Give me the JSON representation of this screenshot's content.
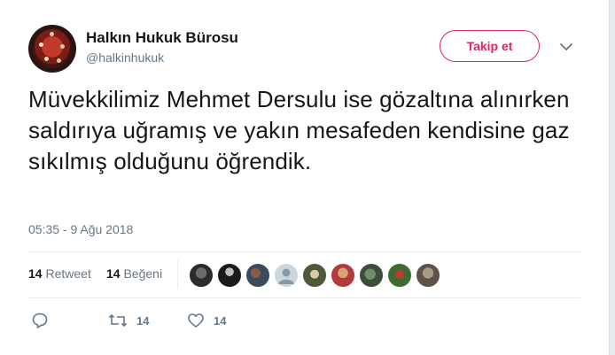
{
  "account": {
    "name": "Halkın Hukuk Bürosu",
    "handle": "@halkinhukuk",
    "follow_label": "Takip et"
  },
  "tweet": {
    "text": "Müvekkilimiz Mehmet Dersulu ise gözaltına alınırken saldırıya uğramış ve yakın mesafeden kendisine gaz sıkılmış olduğunu öğrendik.",
    "timestamp": "05:35 - 9 Ağu 2018"
  },
  "stats": {
    "retweet_count": "14",
    "retweet_label": "Retweet",
    "like_count": "14",
    "like_label": "Beğeni"
  },
  "actions": {
    "retweet_count": "14",
    "like_count": "14"
  },
  "icons": {
    "reply": "reply-icon",
    "retweet": "retweet-icon",
    "like": "heart-icon",
    "more": "chevron-down-icon"
  },
  "colors": {
    "accent": "#e0245e",
    "muted": "#657786",
    "text": "#14171a",
    "divider": "#e6ecf0"
  }
}
